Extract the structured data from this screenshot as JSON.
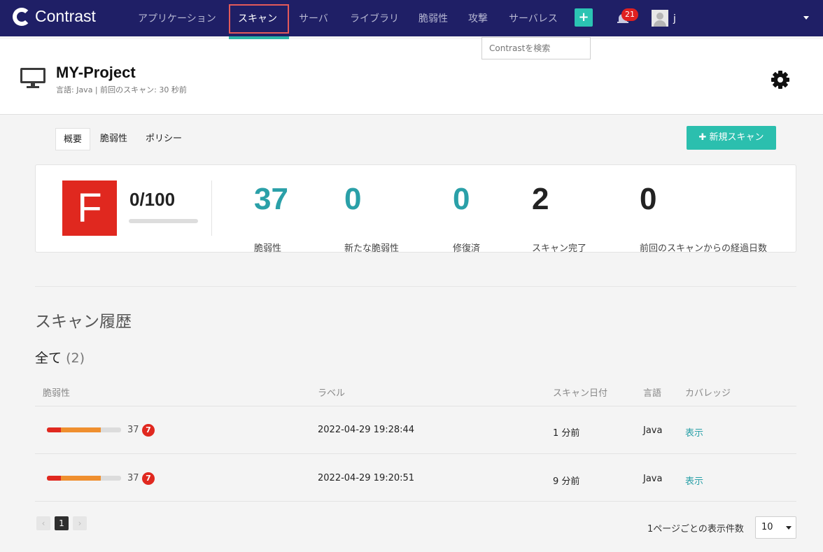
{
  "nav": {
    "logo": "Contrast",
    "items": [
      "アプリケーション",
      "スキャン",
      "サーバ",
      "ライブラリ",
      "脆弱性",
      "攻撃",
      "サーバレス"
    ],
    "plus": "+",
    "notifications": "21",
    "user": "j"
  },
  "search": {
    "placeholder": "Contrastを検索"
  },
  "project": {
    "name": "MY-Project",
    "meta": "言語: Java  |  前回のスキャン: 30 秒前"
  },
  "tabs": [
    "概要",
    "脆弱性",
    "ポリシー"
  ],
  "new_scan_label": "✚ 新規スキャン",
  "summary": {
    "grade": "F",
    "score": "0/100",
    "score_fraction": 0,
    "stats": [
      {
        "value": "37",
        "label": "脆弱性"
      },
      {
        "value": "0",
        "label": "新たな脆弱性"
      },
      {
        "value": "0",
        "label": "修復済"
      },
      {
        "value": "2",
        "label": "スキャン完了"
      },
      {
        "value": "0",
        "label": "前回のスキャンからの経過日数"
      }
    ]
  },
  "history": {
    "title": "スキャン履歴",
    "filter_label": "全て",
    "filter_count": "(2)",
    "columns": [
      "脆弱性",
      "ラベル",
      "スキャン日付",
      "言語",
      "カバレッジ"
    ],
    "rows": [
      {
        "vuln_count": "37",
        "new_badge": "7",
        "label": "2022-04-29 19:28:44",
        "date": "1 分前",
        "language": "Java",
        "coverage": "表示"
      },
      {
        "vuln_count": "37",
        "new_badge": "7",
        "label": "2022-04-29 19:20:51",
        "date": "9 分前",
        "language": "Java",
        "coverage": "表示"
      }
    ]
  },
  "pagination": {
    "prev": "‹",
    "current": "1",
    "next": "›",
    "per_page_label": "1ページごとの表示件数",
    "per_page_value": "10"
  },
  "colors": {
    "nav_bg": "#1f1f66",
    "accent": "#2bbfae",
    "grade_red": "#e0281f",
    "stat_teal": "#2aa0a8",
    "bar_orange": "#ef8f2f"
  }
}
